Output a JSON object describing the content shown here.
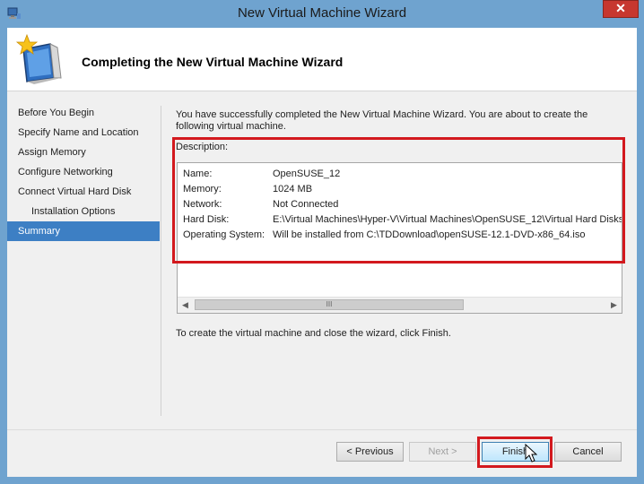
{
  "window": {
    "title": "New Virtual Machine Wizard",
    "close_label": "✕",
    "accent": "#3d7fc4",
    "highlight_color": "#d3191e"
  },
  "header": {
    "title": "Completing the New Virtual Machine Wizard",
    "icon": "wizard-computer-icon"
  },
  "sidebar": {
    "items": [
      {
        "label": "Before You Begin"
      },
      {
        "label": "Specify Name and Location"
      },
      {
        "label": "Assign Memory"
      },
      {
        "label": "Configure Networking"
      },
      {
        "label": "Connect Virtual Hard Disk"
      },
      {
        "label": "Installation Options"
      },
      {
        "label": "Summary"
      }
    ],
    "selected": "Summary"
  },
  "main": {
    "intro": "You have successfully completed the New Virtual Machine Wizard. You are about to create the following virtual machine.",
    "description_label": "Description:",
    "details": [
      {
        "key": "Name:",
        "value": "OpenSUSE_12"
      },
      {
        "key": "Memory:",
        "value": "1024 MB"
      },
      {
        "key": "Network:",
        "value": "Not Connected"
      },
      {
        "key": "Hard Disk:",
        "value": "E:\\Virtual Machines\\Hyper-V\\Virtual Machines\\OpenSUSE_12\\Virtual Hard Disks\\O"
      },
      {
        "key": "Operating System:",
        "value": "Will be installed from C:\\TDDownload\\openSUSE-12.1-DVD-x86_64.iso"
      }
    ],
    "scroll_left": "◀",
    "scroll_right": "▶",
    "scroll_thumb": "III",
    "footer_text": "To create the virtual machine and close the wizard, click Finish."
  },
  "buttons": {
    "previous": "< Previous",
    "next": "Next >",
    "finish": "Finish",
    "cancel": "Cancel"
  }
}
